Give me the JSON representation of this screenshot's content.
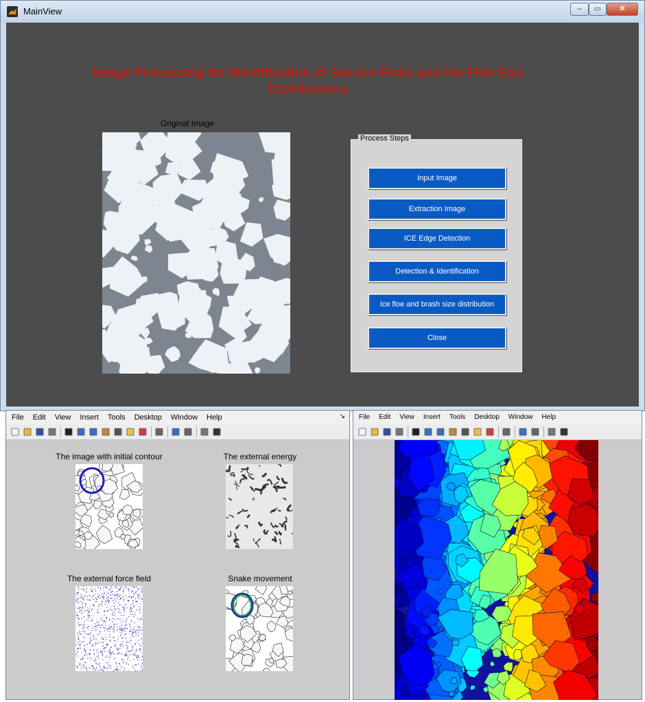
{
  "main_window": {
    "title": "MainView",
    "minimize_glyph": "‒",
    "maximize_glyph": "▭",
    "close_glyph": "✕",
    "headline": "Image Processing for Identification of Sea-Ice Floes and the Floe Size Distributions",
    "original_label": "Original  Image",
    "panel_title": "Process Steps",
    "buttons": {
      "input_image": "Input Image",
      "extraction_image": "Extraction  Image",
      "edge_detection": "ICE Edge Detection",
      "detection_identification": "Detection & Identification",
      "size_distribution": "Ice floe and brash size distribution",
      "close": "Close"
    }
  },
  "figure_left": {
    "menu": [
      "File",
      "Edit",
      "View",
      "Insert",
      "Tools",
      "Desktop",
      "Window",
      "Help"
    ],
    "subplots": {
      "initial_contour": "The image with initial contour",
      "external_energy": "The external energy",
      "external_force": "The external force field",
      "snake_movement": "Snake movement"
    }
  },
  "figure_right": {
    "menu": [
      "File",
      "Edit",
      "View",
      "Insert",
      "Tools",
      "Desktop",
      "Window",
      "Help"
    ]
  },
  "colors": {
    "headline": "#c01e10",
    "button": "#0a5ac4",
    "client_bg": "#4c4c4c",
    "figure_bg": "#cbcbcb"
  },
  "toolbar_icons": [
    "new-file-icon",
    "open-folder-icon",
    "save-icon",
    "print-icon",
    "pointer-icon",
    "zoom-in-icon",
    "zoom-out-icon",
    "pan-icon",
    "rotate-icon",
    "data-cursor-icon",
    "brush-icon",
    "link-icon",
    "colorbar-icon",
    "legend-icon",
    "hide-plot-tools-icon",
    "show-plot-tools-icon"
  ]
}
